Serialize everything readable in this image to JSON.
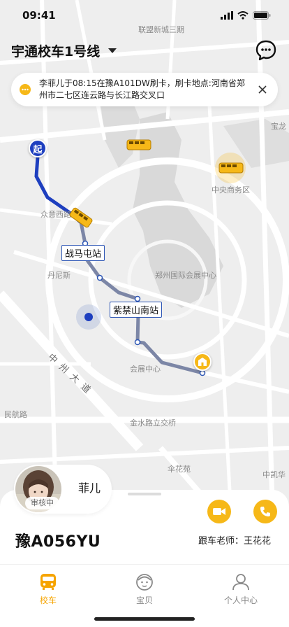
{
  "status_bar": {
    "time": "09:41"
  },
  "header": {
    "route_title": "宇通校车1号线"
  },
  "notice": {
    "text": "李菲儿于08:15在豫A101DW刷卡，刷卡地点:河南省郑州市二七区连云路与长江路交叉口"
  },
  "map": {
    "labels": {
      "top": "联盟新城三期",
      "right_top": "宝龙",
      "cbd": "中央商务区",
      "zhongyi": "众意西路",
      "dannisi": "丹尼斯",
      "convention": "郑州国际会展中心",
      "zhanhui": "会展中心",
      "minhang": "民航路",
      "jinshui": "金水路立交桥",
      "shanhua": "伞花苑",
      "zhongkai": "中凯华",
      "road": "中 州 大 道"
    },
    "start_marker": "起",
    "stops": [
      "战马屯站",
      "紫禁山南站"
    ]
  },
  "child": {
    "name": "菲儿",
    "status": "审核中"
  },
  "vehicle": {
    "plate": "豫A056YU",
    "teacher_label": "跟车老师：",
    "teacher_name": "王花花"
  },
  "tabs": [
    {
      "label": "校车",
      "icon": "bus-icon",
      "active": true
    },
    {
      "label": "宝贝",
      "icon": "baby-icon",
      "active": false
    },
    {
      "label": "个人中心",
      "icon": "person-icon",
      "active": false
    }
  ],
  "colors": {
    "accent": "#f6b818",
    "route": "#1e3fbf",
    "route_upcoming": "#7c86a6",
    "tab_active": "#f6a400"
  }
}
